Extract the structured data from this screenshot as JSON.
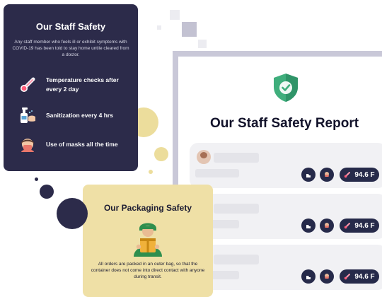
{
  "staff_card": {
    "title": "Our Staff Safety",
    "description": "Any staff member who feels ill or exhibit symptoms with COVID-19 has been told to stay home untile cleared from a doctor.",
    "features": [
      {
        "label": "Temperature checks after every 2 day",
        "icon": "thermometer-icon"
      },
      {
        "label": "Sanitization every 4 hrs",
        "icon": "sanitizer-icon"
      },
      {
        "label": "Use of masks all the time",
        "icon": "mask-icon"
      }
    ]
  },
  "report": {
    "title": "Our Staff Safety Report",
    "icon": "shield-check-icon",
    "cards": [
      {
        "temperature": "94.6 F"
      },
      {
        "temperature": "94.6 F"
      },
      {
        "temperature": "94.6 F"
      }
    ]
  },
  "packaging_card": {
    "title": "Our Packaging Safety",
    "icon": "delivery-person-icon",
    "description": "All orders are packed in an outer bag, so that the container does not come into direct contact with anyone during transit."
  },
  "colors": {
    "navy": "#2c2b4a",
    "gold": "#ecdd9c",
    "shield_green": "#3fae7c"
  }
}
